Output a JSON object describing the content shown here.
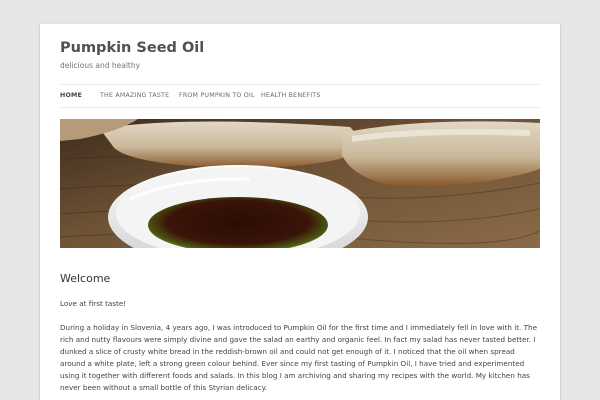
{
  "site": {
    "title": "Pumpkin Seed Oil",
    "description": "delicious and healthy"
  },
  "nav": {
    "items": [
      {
        "label": "HOME",
        "active": true
      },
      {
        "label": "THE AMAZING TASTE",
        "active": false
      },
      {
        "label": "FROM PUMPKIN TO OIL",
        "active": false
      },
      {
        "label": "HEALTH BENEFITS",
        "active": false
      }
    ]
  },
  "header_image": {
    "subject": "bowl of dark pumpkin seed oil with slices of crusty bread on a wooden board"
  },
  "post": {
    "title": "Welcome",
    "paragraphs": [
      "Love at first taste!",
      "During a holiday in Slovenia, 4 years ago, I was introduced to Pumpkin Oil for the first time and I immediately fell in love with it. The rich and nutty flavours were simply divine and gave the salad an earthy and organic feel. In fact my salad has never tasted better. I dunked a slice of crusty white bread in the reddish-brown oil and could not get enough of it. I noticed that the oil when spread around a white plate, left a strong green colour behind. Ever since my first tasting of Pumpkin Oil, I have tried and experimented using it together with different foods and salads. In this blog I am archiving and sharing my recipes with the world. My kitchen has never been without a small bottle of this Styrian delicacy."
    ]
  },
  "colors": {
    "background": "#e6e6e6",
    "page": "#ffffff",
    "title_text": "#515151",
    "body_text": "#444444"
  }
}
